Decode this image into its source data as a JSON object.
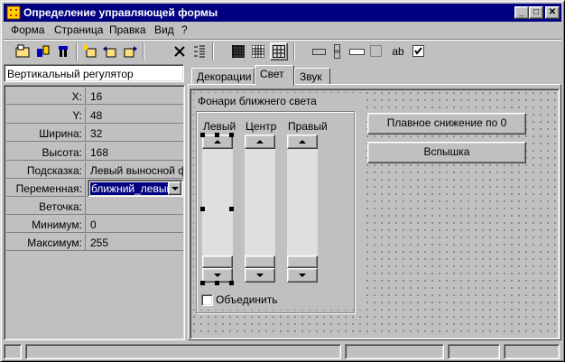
{
  "window": {
    "title": "Определение управляющей формы",
    "minimize_label": "_",
    "maximize_label": "□",
    "close_label": "✕"
  },
  "menubar": {
    "items": [
      {
        "label": "Форма"
      },
      {
        "label": "Страница"
      },
      {
        "label": "Правка"
      },
      {
        "label": "Вид"
      },
      {
        "label": "?"
      }
    ]
  },
  "toolbar": {
    "buttons": [
      {
        "name": "new-form-icon"
      },
      {
        "name": "form-tools-icon"
      },
      {
        "name": "form-bar-icon"
      },
      {
        "name": "add-page-icon"
      },
      {
        "name": "page-left-icon"
      },
      {
        "name": "page-right-icon"
      },
      {
        "name": "delete-icon"
      },
      {
        "name": "list-order-icon"
      },
      {
        "name": "grid-fine-icon"
      },
      {
        "name": "grid-medium-icon"
      },
      {
        "name": "grid-coarse-icon"
      },
      {
        "name": "button-control-icon"
      },
      {
        "name": "slider-control-icon"
      },
      {
        "name": "edit-control-icon"
      },
      {
        "name": "panel-control-icon"
      },
      {
        "name": "text-control-icon"
      },
      {
        "name": "checkbox-control-icon"
      }
    ],
    "text_label": "ab"
  },
  "inspector": {
    "object_name": "Вертикальный регулятор",
    "properties": [
      {
        "label": "X:",
        "value": "16"
      },
      {
        "label": "Y:",
        "value": "48"
      },
      {
        "label": "Ширина:",
        "value": "32"
      },
      {
        "label": "Высота:",
        "value": "168"
      },
      {
        "label": "Подсказка:",
        "value": "Левый выносной фо"
      },
      {
        "label": "Переменная:",
        "value": "ближний_левый"
      },
      {
        "label": "Веточка:",
        "value": ""
      },
      {
        "label": "Минимум:",
        "value": "0"
      },
      {
        "label": "Максимум:",
        "value": "255"
      }
    ]
  },
  "tabs": [
    {
      "label": "Декорации"
    },
    {
      "label": "Свет"
    },
    {
      "label": "Звук"
    }
  ],
  "form": {
    "group_title": "Фонари ближнего света",
    "slider_labels": [
      "Левый",
      "Центр",
      "Правый"
    ],
    "checkbox_label": "Объединить",
    "checkbox_checked": false,
    "button1_label": "Плавное снижение по 0",
    "button2_label": "Вспышка"
  },
  "colors": {
    "titlebar": "#000080",
    "face": "#c0c0c0",
    "selection": "#000080"
  }
}
